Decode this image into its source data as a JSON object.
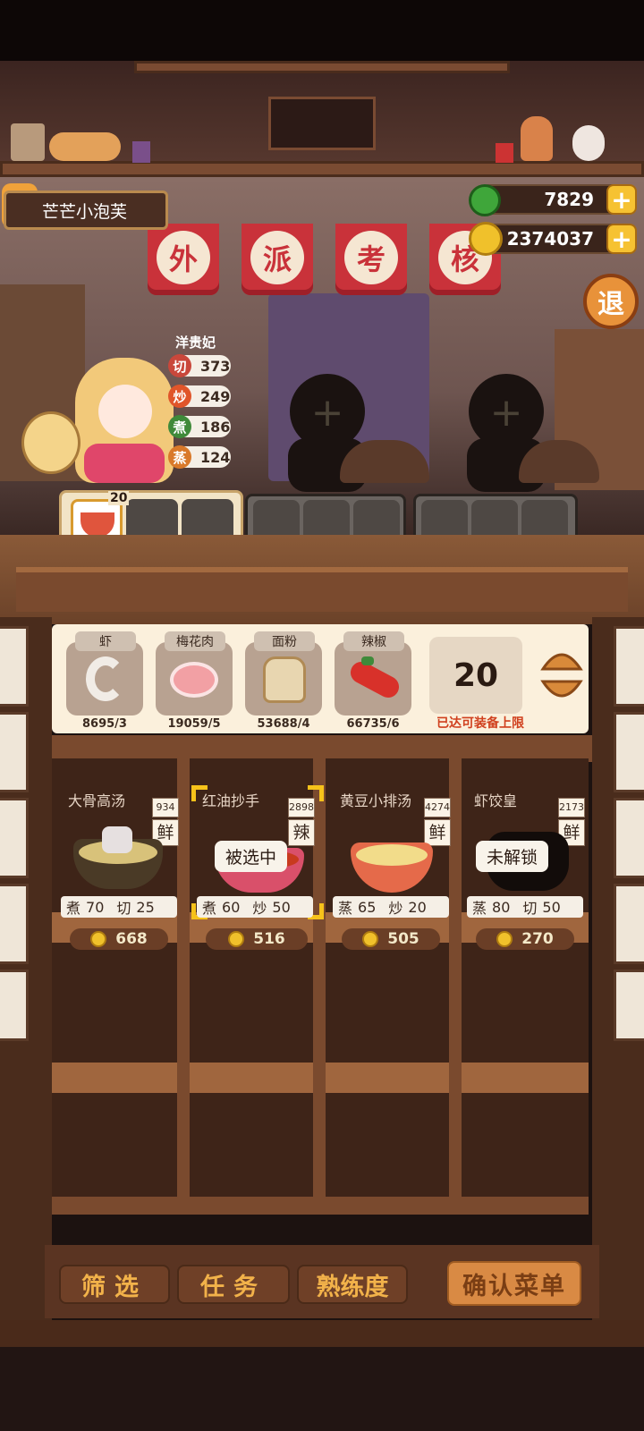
{
  "player": {
    "name": "芒芒小泡芙"
  },
  "currency": {
    "jade": "7829",
    "gold": "2374037"
  },
  "banners": [
    "外",
    "派",
    "考",
    "核"
  ],
  "exit_label": "退",
  "chef": {
    "name": "洋贵妃",
    "stats": [
      {
        "icon": "切",
        "value": "373",
        "color": "#c9473b"
      },
      {
        "icon": "炒",
        "value": "249",
        "color": "#e0552a"
      },
      {
        "icon": "煮",
        "value": "186",
        "color": "#3f8a3a"
      },
      {
        "icon": "蒸",
        "value": "124",
        "color": "#d9792a"
      }
    ]
  },
  "menu_slot": {
    "count": "20"
  },
  "ingredients": [
    {
      "name": "虾",
      "count": "8695/3"
    },
    {
      "name": "梅花肉",
      "count": "19059/5"
    },
    {
      "name": "面粉",
      "count": "53688/4"
    },
    {
      "name": "辣椒",
      "count": "66735/6"
    }
  ],
  "quantity": {
    "value": "20",
    "note": "已达可装备上限"
  },
  "dishes": [
    {
      "name": "大骨高汤",
      "num": "934",
      "flavor": "鲜",
      "m1": "煮",
      "v1": "70",
      "m2": "切",
      "v2": "25",
      "price": "668",
      "overlay": ""
    },
    {
      "name": "红油抄手",
      "num": "2898",
      "flavor": "辣",
      "m1": "煮",
      "v1": "60",
      "m2": "炒",
      "v2": "50",
      "price": "516",
      "overlay": "被选中"
    },
    {
      "name": "黄豆小排汤",
      "num": "4274",
      "flavor": "鲜",
      "m1": "蒸",
      "v1": "65",
      "m2": "炒",
      "v2": "20",
      "price": "505",
      "overlay": ""
    },
    {
      "name": "虾饺皇",
      "num": "2173",
      "flavor": "鲜",
      "m1": "蒸",
      "v1": "80",
      "m2": "切",
      "v2": "50",
      "price": "270",
      "overlay": "未解锁"
    }
  ],
  "buttons": {
    "filter": "筛选",
    "task": "任务",
    "proficiency": "熟练度",
    "confirm": "确认菜单"
  }
}
